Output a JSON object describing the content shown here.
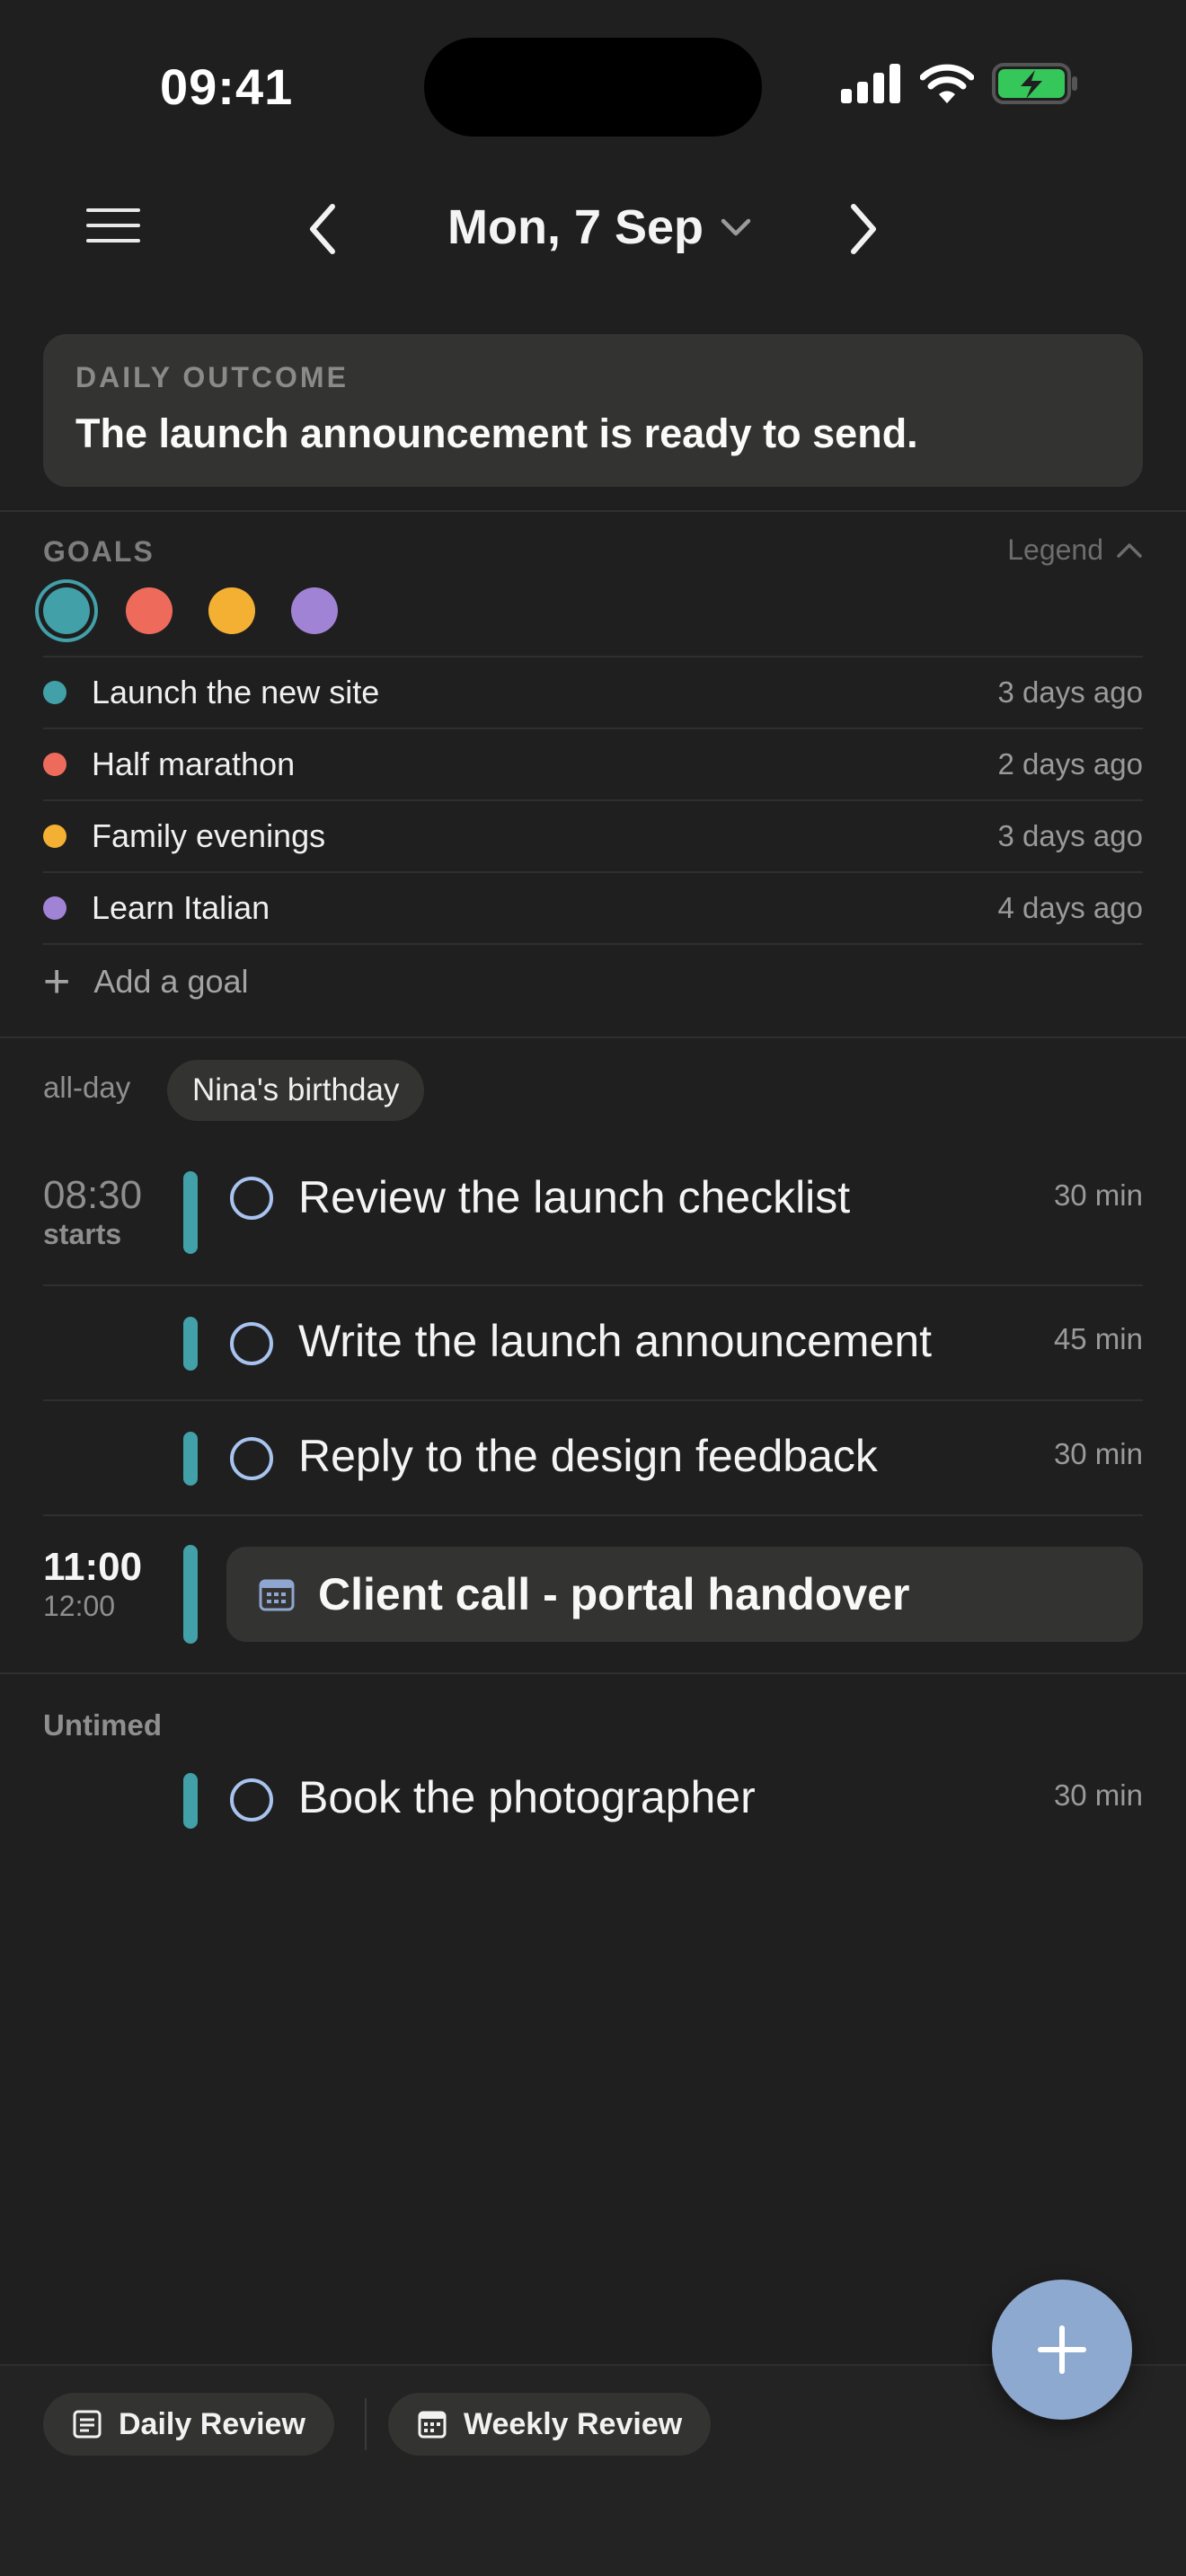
{
  "status_bar": {
    "time": "09:41"
  },
  "header": {
    "date": "Mon, 7 Sep"
  },
  "outcome": {
    "label": "DAILY OUTCOME",
    "text": "The launch announcement is ready to send."
  },
  "goals": {
    "label": "GOALS",
    "legend_label": "Legend",
    "colors": [
      "#41a0a8",
      "#ee6b5c",
      "#f4b033",
      "#a083d4"
    ],
    "items": [
      {
        "name": "Launch the new site",
        "ago": "3 days ago",
        "color": "#41a0a8"
      },
      {
        "name": "Half marathon",
        "ago": "2 days ago",
        "color": "#ee6b5c"
      },
      {
        "name": "Family evenings",
        "ago": "3 days ago",
        "color": "#f4b033"
      },
      {
        "name": "Learn Italian",
        "ago": "4 days ago",
        "color": "#a083d4"
      }
    ],
    "add_label": "Add a goal"
  },
  "allday": {
    "label": "all-day",
    "event": "Nina's birthday"
  },
  "schedule": {
    "block1": {
      "time": "08:30",
      "sub": "starts"
    },
    "tasks": [
      {
        "title": "Review the launch checklist",
        "duration": "30 min"
      },
      {
        "title": "Write the launch announcement",
        "duration": "45 min"
      },
      {
        "title": "Reply to the design feedback",
        "duration": "30 min"
      }
    ],
    "event": {
      "start": "11:00",
      "end": "12:00",
      "title": "Client call - portal handover"
    },
    "untimed_label": "Untimed",
    "untimed_tasks": [
      {
        "title": "Book the photographer",
        "duration": "30 min"
      }
    ]
  },
  "bottom": {
    "daily_review": "Daily Review",
    "weekly_review": "Weekly Review"
  },
  "accent": "#41a0a8"
}
